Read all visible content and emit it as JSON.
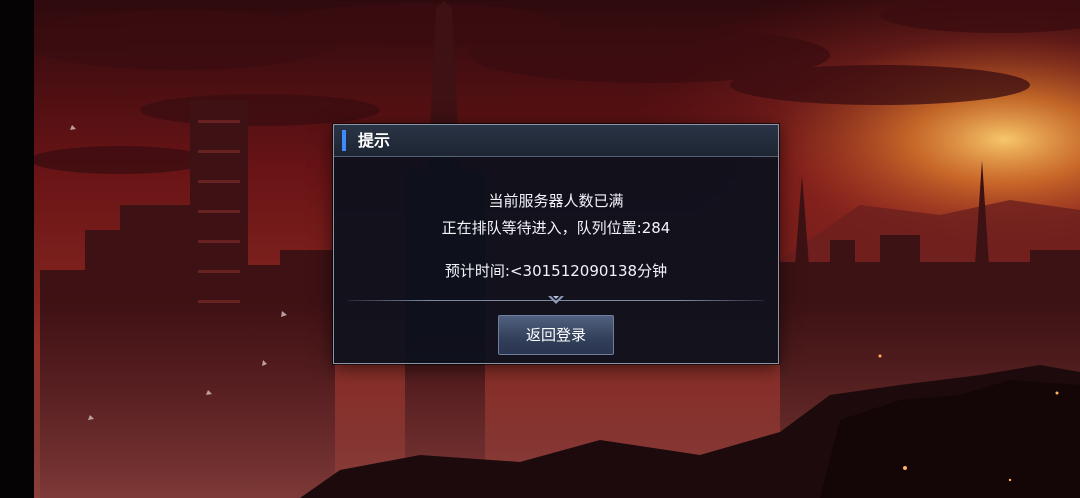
{
  "dialog": {
    "title": "提示",
    "line1": "当前服务器人数已满",
    "line2": "正在排队等待进入，队列位置:284",
    "line3": "预计时间:<301512090138分钟",
    "return_button_label": "返回登录"
  },
  "colors": {
    "accent": "#3d8bff",
    "dialog_bg": "#0a101c",
    "button_bg": "#3b4864",
    "sky_top": "#3a0c10",
    "sunset": "#f0a030"
  },
  "icons": {
    "divider": "chevron-down-icon"
  }
}
